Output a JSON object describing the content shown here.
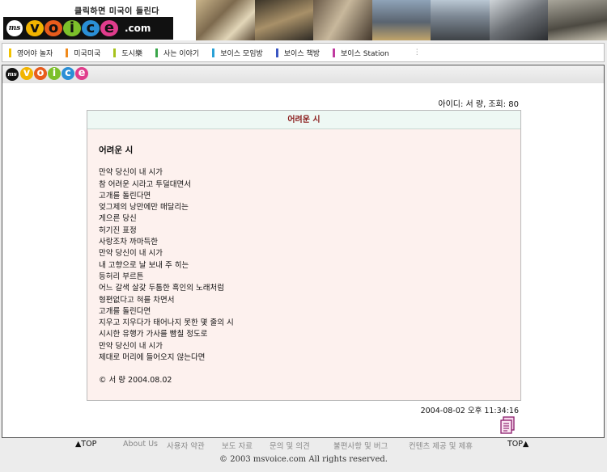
{
  "banner": {
    "slogan": "클릭하면 미국이 들린다",
    "logo_ms": "ms",
    "logo_letters": [
      "v",
      "o",
      "i",
      "c",
      "e"
    ],
    "logo_dotcom": ".com",
    "colors": {
      "v": "#f2b400",
      "o": "#e85c1c",
      "i": "#7cc02a",
      "c": "#2a8fd6",
      "e": "#e03c8c"
    }
  },
  "nav": {
    "items": [
      {
        "label": "영어야 놀자",
        "color": "#f2c200"
      },
      {
        "label": "미국미국",
        "color": "#f08a1c"
      },
      {
        "label": "도시樂",
        "color": "#a7c21c"
      },
      {
        "label": "사는 이야기",
        "color": "#3aa64a"
      },
      {
        "label": "보이스 모임방",
        "color": "#2aa1d6"
      },
      {
        "label": "보이스 책방",
        "color": "#3a56c2"
      },
      {
        "label": "보이스 Station",
        "color": "#c03aa0"
      }
    ],
    "trailing": "⋮"
  },
  "sub_logo": {
    "ms": "ms",
    "letters": [
      "v",
      "o",
      "i",
      "c",
      "e"
    ]
  },
  "post": {
    "meta_author": "아이디: 서 량,",
    "meta_views": "조회: 80",
    "title": "어려운 시",
    "heading": "어려운 시",
    "lines": [
      "만약 당신이 내 시가",
      "참 어려운 시라고 투덜대면서",
      "고개를 돌린다면",
      "엊그제의 낭만에만 매달리는",
      "게으른 당신",
      "허기진 표정",
      "사랑조차 까마득한",
      "만약 당신이 내 시가",
      "내 고향으로 날 보내 주 히는",
      "등허리 부르튼",
      "어느 갈색 살갗 두툼한 흑인의 노래처럼",
      "형편없다고 혀를 차면서",
      "고개를 돌린다면",
      "지우고 지우다가 태어나지 못한 몇 줄의 시",
      "시시한 유행가 가사를 빰칠 정도로",
      "만약 당신이 내 시가",
      "제대로 머리에 들어오지 않는다면"
    ],
    "signature": "© 서 량 2004.08.02",
    "date": "2004-08-02 오후 11:34:16"
  },
  "footer": {
    "top_left": "▲TOP",
    "links": [
      "About Us",
      "사용자 약관",
      "보도 자료",
      "문의 및 의견",
      "불편사항 및 버그",
      "컨텐츠 제공 및 제휴"
    ],
    "top_right": "TOP▲",
    "copyright": "© 2003 msvoice.com All rights reserved."
  }
}
